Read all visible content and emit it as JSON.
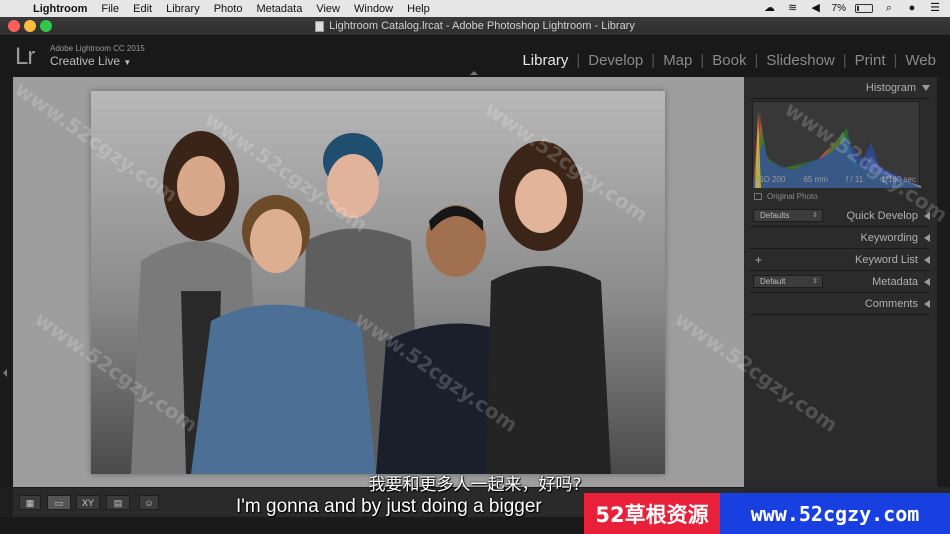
{
  "menubar": {
    "items": [
      "Lightroom",
      "File",
      "Edit",
      "Library",
      "Photo",
      "Metadata",
      "View",
      "Window",
      "Help"
    ],
    "battery": "7%"
  },
  "window": {
    "title": "Lightroom Catalog.lrcat - Adobe Photoshop Lightroom - Library"
  },
  "identity": {
    "logo": "Lr",
    "version": "Adobe Lightroom CC 2015",
    "catalog": "Creative Live",
    "catalog_caret": "▼"
  },
  "modules": [
    "Library",
    "Develop",
    "Map",
    "Book",
    "Slideshow",
    "Print",
    "Web"
  ],
  "active_module": "Library",
  "panels": {
    "histogram": {
      "title": "Histogram",
      "iso": "ISO 200",
      "focal": "65 mm",
      "aperture": "f / 11",
      "shutter": "1/160 sec",
      "original_photo": "Original Photo"
    },
    "quick_develop": {
      "title": "Quick Develop",
      "preset": "Defaults"
    },
    "keywording": {
      "title": "Keywording"
    },
    "keyword_list": {
      "title": "Keyword List",
      "plus": "+"
    },
    "metadata": {
      "title": "Metadata",
      "preset": "Default"
    },
    "comments": {
      "title": "Comments"
    }
  },
  "subtitles": {
    "chinese": "我要和更多人一起来，好吗?",
    "english": "I'm gonna and by just doing a bigger"
  },
  "watermark": {
    "left": "52草根资源",
    "right": "www.52cgzy.com",
    "diagonal": "www.52cgzy.com"
  },
  "colors": {
    "active_module": "#e8e8e8",
    "inactive_module": "#8a8a8a",
    "canvas": "#9e9e9e",
    "banner_red": "#e8203a",
    "banner_blue": "#1840e0"
  }
}
